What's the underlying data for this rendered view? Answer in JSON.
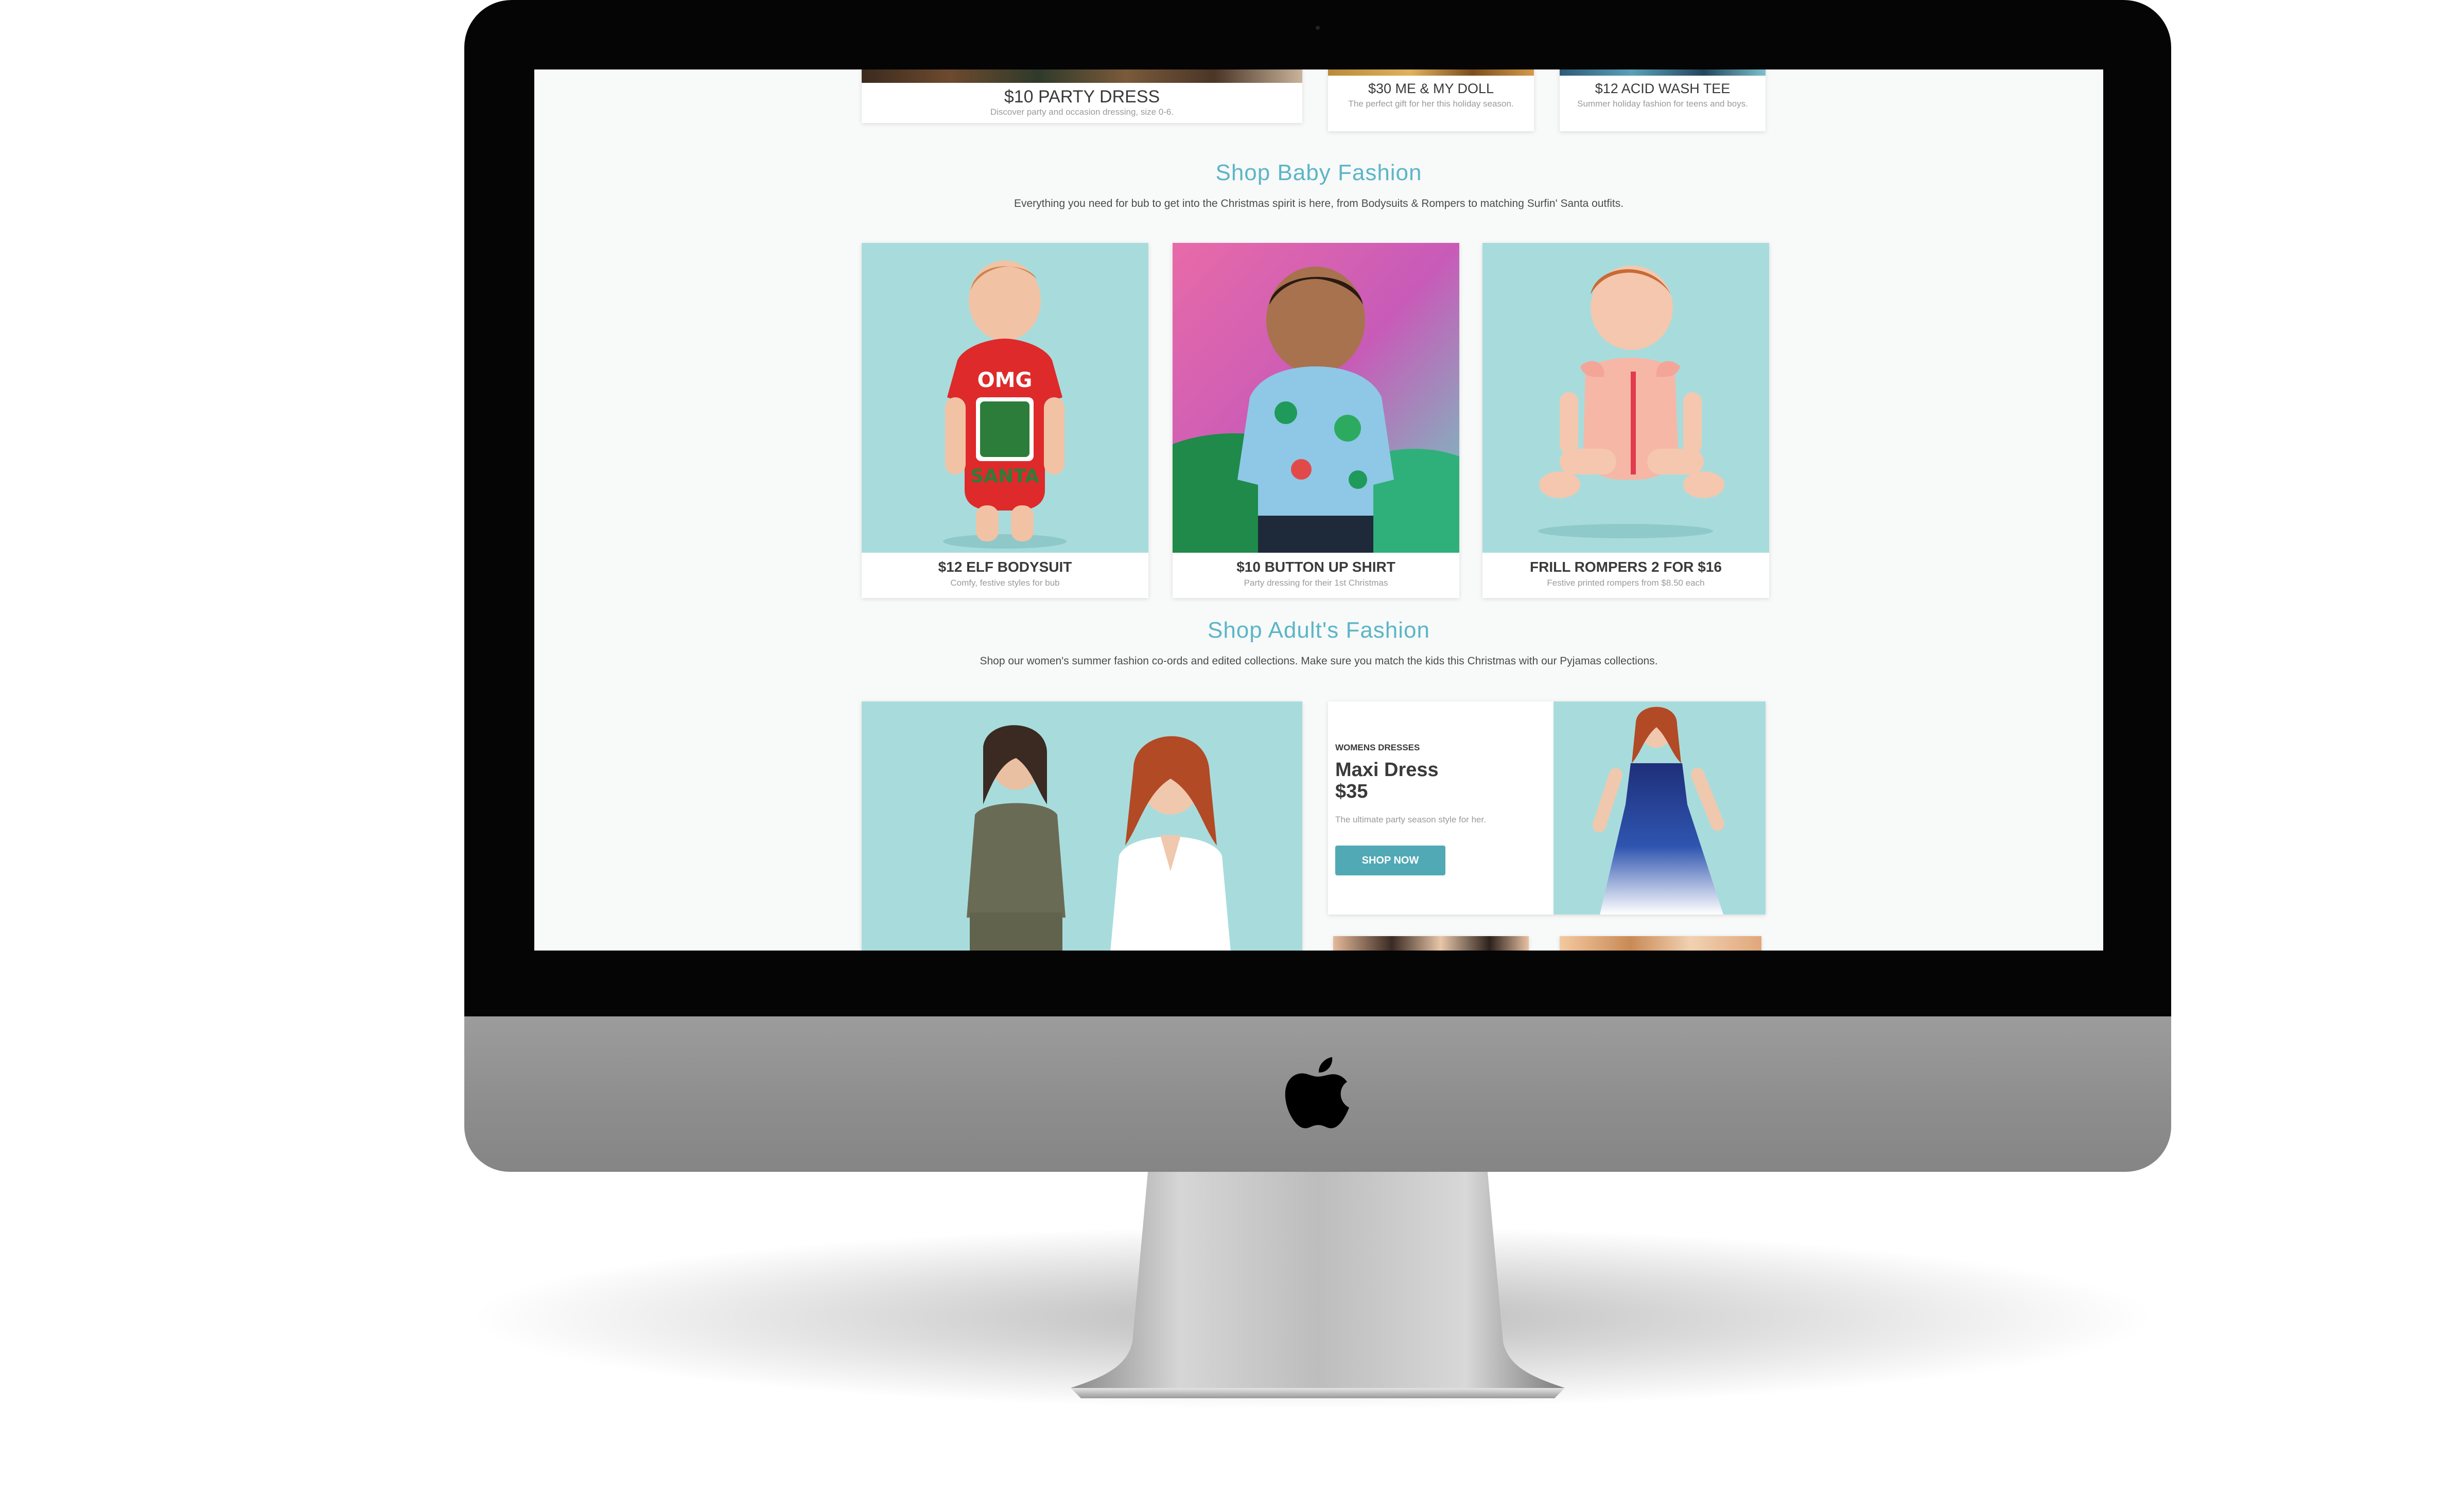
{
  "top_cards": [
    {
      "title": "$10 PARTY DRESS",
      "subtitle": "Discover party and occasion dressing, size 0-6."
    },
    {
      "title": "$30 ME & MY DOLL",
      "subtitle": "The perfect gift for her this holiday season."
    },
    {
      "title": "$12 ACID WASH TEE",
      "subtitle": "Summer holiday fashion for teens and boys."
    }
  ],
  "baby_section": {
    "heading": "Shop Baby Fashion",
    "intro": "Everything you need for bub to get into the Christmas spirit is here, from Bodysuits & Rompers to matching Surfin' Santa outfits.",
    "cards": [
      {
        "title": "$12 ELF BODYSUIT",
        "subtitle": "Comfy, festive styles for bub",
        "shirt_text_top": "OMG",
        "shirt_text_bottom": "SANTA"
      },
      {
        "title": "$10 BUTTON UP SHIRT",
        "subtitle": "Party dressing for their 1st Christmas"
      },
      {
        "title": "FRILL ROMPERS 2 FOR $16",
        "subtitle": "Festive printed rompers from $8.50 each"
      }
    ]
  },
  "adult_section": {
    "heading": "Shop Adult's Fashion",
    "intro": "Shop our women's summer fashion co-ords and edited collections. Make sure you match the kids this Christmas with our Pyjamas collections.",
    "promo": {
      "eyebrow": "WOMENS DRESSES",
      "title_line1": "Maxi Dress",
      "title_line2": "$35",
      "description": "The ultimate party season style for her.",
      "button": "SHOP NOW"
    }
  },
  "colors": {
    "accent": "#5bb6c6",
    "button": "#51a9b6",
    "photo_bg": "#a8dcdc",
    "page_bg": "#f8f9f9"
  },
  "icons": [
    "apple-logo-icon"
  ]
}
